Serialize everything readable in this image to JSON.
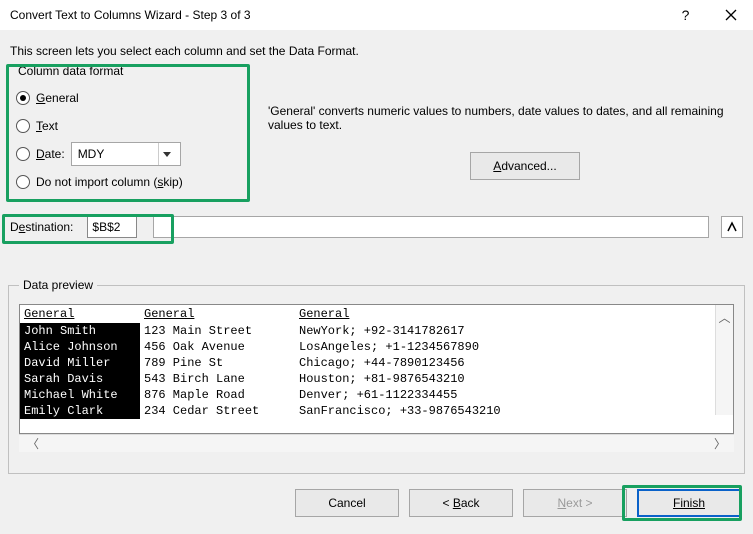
{
  "titlebar": {
    "title": "Convert Text to Columns Wizard - Step 3 of 3"
  },
  "instruction": "This screen lets you select each column and set the Data Format.",
  "group": {
    "legend": "Column data format",
    "general": "General",
    "text": "Text",
    "date": "Date:",
    "date_value": "MDY",
    "skip": "Do not import column (skip)"
  },
  "desc": "'General' converts numeric values to numbers, date values to dates, and all remaining values to text.",
  "advanced": "Advanced...",
  "destination": {
    "label": "Destination:",
    "value": "$B$2"
  },
  "preview": {
    "legend": "Data preview",
    "headers": [
      "General",
      "General",
      "General"
    ],
    "rows": [
      [
        "John Smith",
        "123 Main Street",
        "NewYork; +92-3141782617"
      ],
      [
        "Alice Johnson",
        "456 Oak Avenue",
        "LosAngeles; +1-1234567890"
      ],
      [
        "David Miller",
        "789 Pine St",
        "Chicago; +44-7890123456"
      ],
      [
        "Sarah Davis",
        "543 Birch Lane",
        "Houston; +81-9876543210"
      ],
      [
        "Michael White",
        "876 Maple Road",
        "Denver; +61-1122334455"
      ],
      [
        "Emily Clark",
        "234 Cedar Street",
        "SanFrancisco; +33-9876543210"
      ]
    ]
  },
  "buttons": {
    "cancel": "Cancel",
    "back": "< Back",
    "next": "Next >",
    "finish": "Finish"
  }
}
